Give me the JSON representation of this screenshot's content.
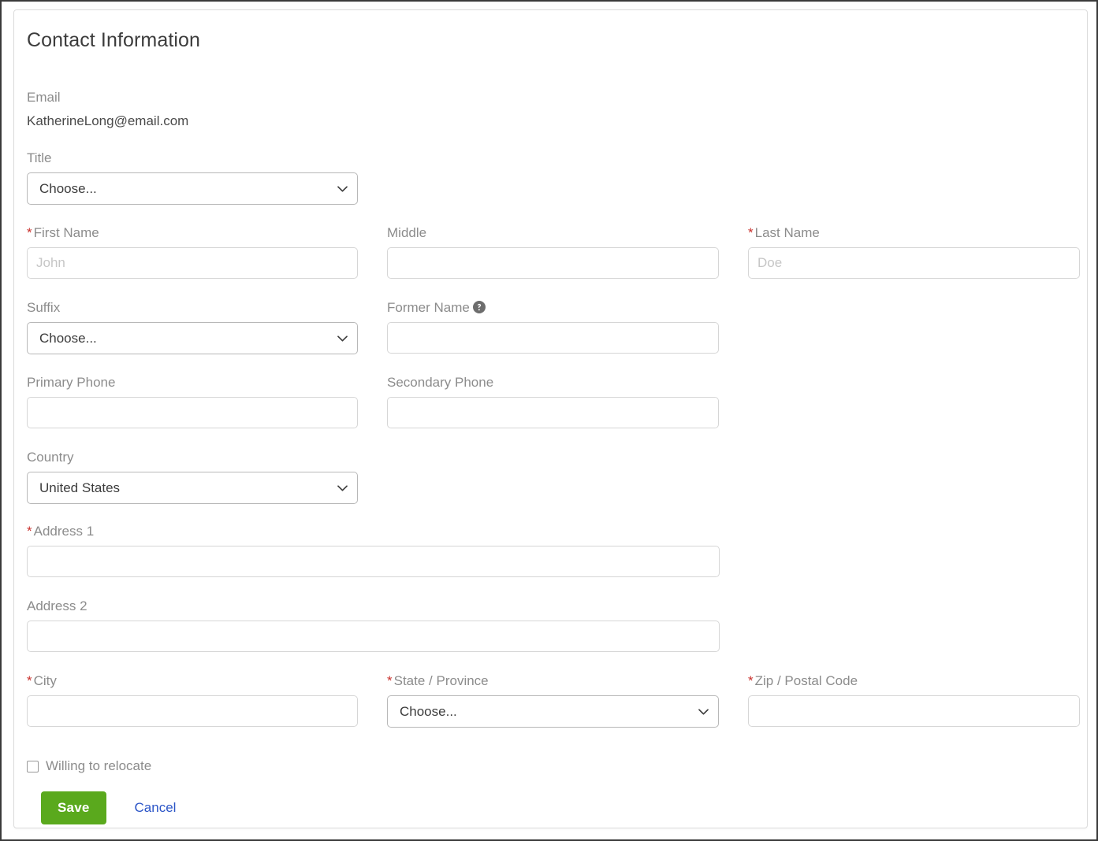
{
  "card": {
    "title": "Contact Information"
  },
  "email": {
    "label": "Email",
    "value": "KatherineLong@email.com"
  },
  "title_field": {
    "label": "Title",
    "value": "Choose...",
    "options": [
      "Choose..."
    ]
  },
  "first_name": {
    "required_mark": "*",
    "label": "First Name",
    "value": "",
    "placeholder": "John"
  },
  "middle": {
    "label": "Middle",
    "value": "",
    "placeholder": ""
  },
  "last_name": {
    "required_mark": "*",
    "label": "Last Name",
    "value": "",
    "placeholder": "Doe"
  },
  "suffix": {
    "label": "Suffix",
    "value": "Choose...",
    "options": [
      "Choose..."
    ]
  },
  "former_name": {
    "label": "Former Name",
    "help_icon": "help-circle-icon",
    "value": "",
    "placeholder": ""
  },
  "primary_phone": {
    "label": "Primary Phone",
    "value": "",
    "placeholder": ""
  },
  "secondary_phone": {
    "label": "Secondary Phone",
    "value": "",
    "placeholder": ""
  },
  "country": {
    "label": "Country",
    "value": "United States",
    "options": [
      "United States"
    ]
  },
  "address1": {
    "required_mark": "*",
    "label": "Address 1",
    "value": "",
    "placeholder": ""
  },
  "address2": {
    "label": "Address 2",
    "value": "",
    "placeholder": ""
  },
  "city": {
    "required_mark": "*",
    "label": "City",
    "value": "",
    "placeholder": ""
  },
  "state": {
    "required_mark": "*",
    "label": "State / Province",
    "value": "Choose...",
    "options": [
      "Choose..."
    ]
  },
  "zip": {
    "required_mark": "*",
    "label": "Zip / Postal Code",
    "value": "",
    "placeholder": ""
  },
  "relocate": {
    "label": "Willing to relocate",
    "checked": false
  },
  "actions": {
    "save_label": "Save",
    "cancel_label": "Cancel"
  },
  "colors": {
    "save_green": "#5aa91d",
    "cancel_blue": "#2b55c7",
    "required_red": "#c9302c",
    "label_gray": "#8c8c8c",
    "text_dark": "#3c3c3c",
    "input_border": "#d6d6d6"
  }
}
